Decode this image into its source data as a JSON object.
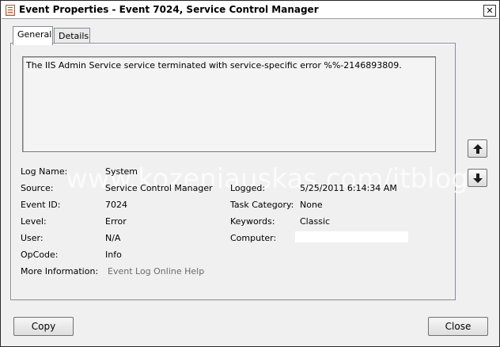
{
  "window": {
    "title": "Event Properties - Event 7024, Service Control Manager",
    "close_glyph": "✕"
  },
  "tabs": [
    {
      "label": "General",
      "active": true
    },
    {
      "label": "Details",
      "active": false
    }
  ],
  "description": "The IIS Admin Service service terminated with service-specific error %%-2146893809.",
  "fields": {
    "log_name": {
      "label": "Log Name:",
      "value": "System"
    },
    "source": {
      "label": "Source:",
      "value": "Service Control Manager"
    },
    "event_id": {
      "label": "Event ID:",
      "value": "7024"
    },
    "level": {
      "label": "Level:",
      "value": "Error"
    },
    "user": {
      "label": "User:",
      "value": "N/A"
    },
    "opcode": {
      "label": "OpCode:",
      "value": "Info"
    },
    "more_info": {
      "label": "More Information:",
      "value": "Event Log Online Help"
    },
    "logged": {
      "label": "Logged:",
      "value": "5/25/2011 6:14:34 AM"
    },
    "task_category": {
      "label": "Task Category:",
      "value": "None"
    },
    "keywords": {
      "label": "Keywords:",
      "value": "Classic"
    },
    "computer": {
      "label": "Computer:",
      "value": ""
    }
  },
  "watermark": "www.kozeniauskas.com/itblog",
  "buttons": {
    "copy": "Copy",
    "close": "Close"
  },
  "icons": {
    "up": "arrow-up-icon",
    "down": "arrow-down-icon"
  }
}
